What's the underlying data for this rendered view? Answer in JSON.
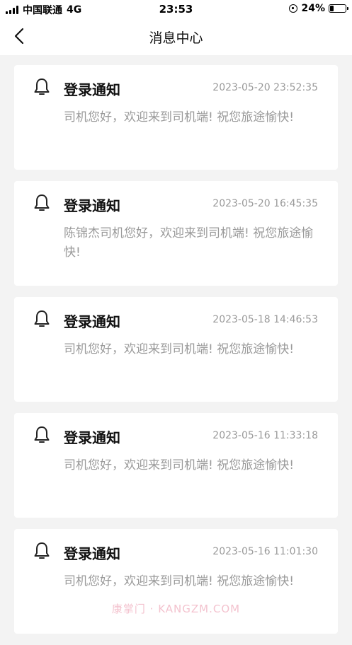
{
  "status_bar": {
    "carrier": "中国联通",
    "network": "4G",
    "time": "23:53",
    "battery_percent": "24%",
    "battery_level": 0.24
  },
  "nav": {
    "title": "消息中心"
  },
  "messages": [
    {
      "title": "登录通知",
      "time": "2023-05-20 23:52:35",
      "body": "司机您好，欢迎来到司机端! 祝您旅途愉快!"
    },
    {
      "title": "登录通知",
      "time": "2023-05-20 16:45:35",
      "body": "陈锦杰司机您好，欢迎来到司机端! 祝您旅途愉快!"
    },
    {
      "title": "登录通知",
      "time": "2023-05-18 14:46:53",
      "body": "司机您好，欢迎来到司机端! 祝您旅途愉快!"
    },
    {
      "title": "登录通知",
      "time": "2023-05-16 11:33:18",
      "body": "司机您好，欢迎来到司机端! 祝您旅途愉快!"
    },
    {
      "title": "登录通知",
      "time": "2023-05-16 11:01:30",
      "body": "司机您好，欢迎来到司机端! 祝您旅途愉快!"
    }
  ],
  "watermark": "康掌门 · KANGZM.COM",
  "colors": {
    "background": "#f3f3f3",
    "card": "#ffffff",
    "muted_text": "#9a9a9a",
    "title_text": "#111111"
  }
}
